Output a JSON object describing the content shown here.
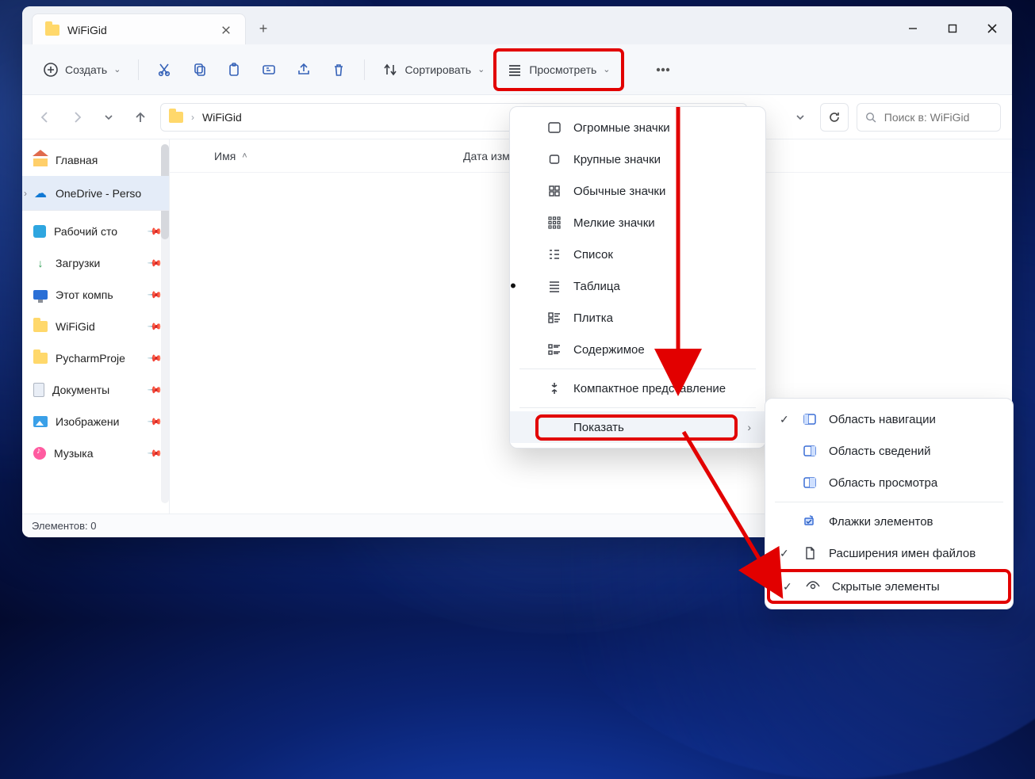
{
  "titlebar_tts": "...",
  "tab": {
    "title": "WiFiGid"
  },
  "toolbar": {
    "create_label": "Создать",
    "sort_label": "Сортировать",
    "view_label": "Просмотреть"
  },
  "address": {
    "crumb": "WiFiGid"
  },
  "search": {
    "placeholder": "Поиск в: WiFiGid"
  },
  "columns": {
    "name": "Имя",
    "date": "Дата изме"
  },
  "sidebar": {
    "home": "Главная",
    "onedrive": "OneDrive - Perso",
    "items": [
      {
        "label": "Рабочий сто"
      },
      {
        "label": "Загрузки"
      },
      {
        "label": "Этот компь"
      },
      {
        "label": "WiFiGid"
      },
      {
        "label": "PycharmProje"
      },
      {
        "label": "Документы"
      },
      {
        "label": "Изображени"
      },
      {
        "label": "Музыка"
      }
    ]
  },
  "statusbar": {
    "text": "Элементов: 0"
  },
  "view_menu": {
    "items": [
      {
        "label": "Огромные значки"
      },
      {
        "label": "Крупные значки"
      },
      {
        "label": "Обычные значки"
      },
      {
        "label": "Мелкие значки"
      },
      {
        "label": "Список"
      },
      {
        "label": "Таблица"
      },
      {
        "label": "Плитка"
      },
      {
        "label": "Содержимое"
      },
      {
        "label": "Компактное представление"
      },
      {
        "label": "Показать"
      }
    ]
  },
  "show_menu": {
    "items": [
      {
        "label": "Область навигации",
        "checked": true
      },
      {
        "label": "Область сведений",
        "checked": false
      },
      {
        "label": "Область просмотра",
        "checked": false
      },
      {
        "label": "Флажки элементов",
        "checked": false
      },
      {
        "label": "Расширения имен файлов",
        "checked": true
      },
      {
        "label": "Скрытые элементы",
        "checked": true
      }
    ]
  }
}
